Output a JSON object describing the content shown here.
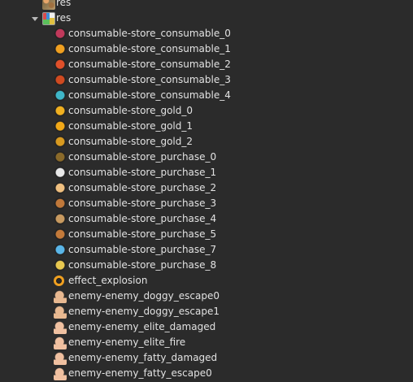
{
  "tree": {
    "parent_folder": {
      "label": "res",
      "icon": "spritesheet-icon"
    },
    "folder": {
      "label": "res",
      "icon": "atlas-folder-icon",
      "expanded": true
    },
    "items": [
      {
        "label": "consumable-store_consumable_0",
        "icon": "potion-icon",
        "color": "#c0395b"
      },
      {
        "label": "consumable-store_consumable_1",
        "icon": "chick-icon",
        "color": "#f0a020"
      },
      {
        "label": "consumable-store_consumable_2",
        "icon": "runner-icon",
        "color": "#e0502a"
      },
      {
        "label": "consumable-store_consumable_3",
        "icon": "wings-icon",
        "color": "#d04a20"
      },
      {
        "label": "consumable-store_consumable_4",
        "icon": "card-icon",
        "color": "#3fb6c8"
      },
      {
        "label": "consumable-store_gold_0",
        "icon": "coins-icon",
        "color": "#f0b020"
      },
      {
        "label": "consumable-store_gold_1",
        "icon": "gold-bars-icon",
        "color": "#f0a818"
      },
      {
        "label": "consumable-store_gold_2",
        "icon": "gold-pile-icon",
        "color": "#d89a20"
      },
      {
        "label": "consumable-store_purchase_0",
        "icon": "plant-icon",
        "color": "#8a6a2a"
      },
      {
        "label": "consumable-store_purchase_1",
        "icon": "skull-icon",
        "color": "#e8e8e8"
      },
      {
        "label": "consumable-store_purchase_2",
        "icon": "face-icon",
        "color": "#f0c080"
      },
      {
        "label": "consumable-store_purchase_3",
        "icon": "chest-icon",
        "color": "#c0783a"
      },
      {
        "label": "consumable-store_purchase_4",
        "icon": "mountain-icon",
        "color": "#c89a60"
      },
      {
        "label": "consumable-store_purchase_5",
        "icon": "barrel-icon",
        "color": "#c47a3a"
      },
      {
        "label": "consumable-store_purchase_7",
        "icon": "portrait-icon",
        "color": "#5ab6e8"
      },
      {
        "label": "consumable-store_purchase_8",
        "icon": "banner-icon",
        "color": "#e8c850"
      },
      {
        "label": "effect_explosion",
        "icon": "ring-icon",
        "color": "#f0a020"
      },
      {
        "label": "enemy-enemy_doggy_escape0",
        "icon": "creature-icon",
        "color": "#e8b890"
      },
      {
        "label": "enemy-enemy_doggy_escape1",
        "icon": "creature-icon",
        "color": "#e8b890"
      },
      {
        "label": "enemy-enemy_elite_damaged",
        "icon": "creature-icon",
        "color": "#f0c0a0"
      },
      {
        "label": "enemy-enemy_elite_fire",
        "icon": "creature-icon",
        "color": "#f0c0a0"
      },
      {
        "label": "enemy-enemy_fatty_damaged",
        "icon": "creature-icon",
        "color": "#f0c0a0"
      },
      {
        "label": "enemy-enemy_fatty_escape0",
        "icon": "creature-icon",
        "color": "#f0c0a0"
      }
    ]
  }
}
